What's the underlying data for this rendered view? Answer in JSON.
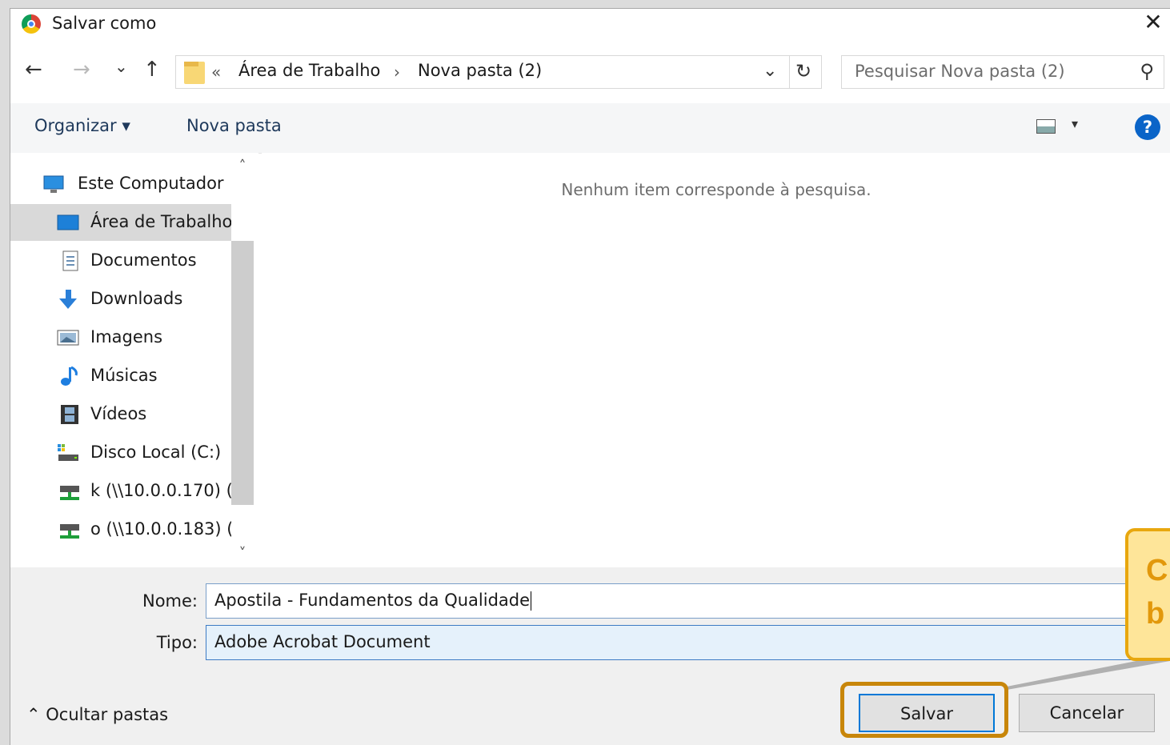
{
  "window": {
    "title": "Salvar como",
    "close_glyph": "✕"
  },
  "nav": {
    "back_glyph": "←",
    "forward_glyph": "→",
    "recent_glyph": "⌄",
    "up_glyph": "↑",
    "breadcrumb_overflow": "«",
    "breadcrumb": [
      "Área de Trabalho",
      "Nova pasta (2)"
    ],
    "breadcrumb_sep": "›",
    "dropdown_glyph": "⌄",
    "refresh_glyph": "↻",
    "search_placeholder": "Pesquisar Nova pasta (2)",
    "search_glyph": "⚲"
  },
  "toolbar": {
    "organize": "Organizar ▾",
    "new_folder": "Nova pasta",
    "view_dd": "▾",
    "help": "?"
  },
  "sidebar": {
    "items": [
      {
        "label": "Este Computador",
        "icon": "computer-icon"
      },
      {
        "label": "Área de Trabalho",
        "icon": "desktop-icon",
        "selected": true
      },
      {
        "label": "Documentos",
        "icon": "documents-icon"
      },
      {
        "label": "Downloads",
        "icon": "downloads-icon"
      },
      {
        "label": "Imagens",
        "icon": "pictures-icon"
      },
      {
        "label": "Músicas",
        "icon": "music-icon"
      },
      {
        "label": "Vídeos",
        "icon": "videos-icon"
      },
      {
        "label": "Disco Local (C:)",
        "icon": "drive-icon"
      },
      {
        "label": "k (\\\\10.0.0.170) (",
        "icon": "network-drive-icon"
      },
      {
        "label": "o (\\\\10.0.0.183) (",
        "icon": "network-drive-icon"
      }
    ],
    "scroll_up": "˄",
    "scroll_down": "˅"
  },
  "content": {
    "empty_message": "Nenhum item corresponde à pesquisa."
  },
  "form": {
    "name_label": "Nome:",
    "name_value": "Apostila - Fundamentos da Qualidade",
    "type_label": "Tipo:",
    "type_value": "Adobe Acrobat Document"
  },
  "footer": {
    "hide_folders": "⌃  Ocultar pastas",
    "save": "Salvar",
    "cancel": "Cancelar"
  },
  "callout": {
    "line1": "C",
    "line2": "b"
  },
  "colors": {
    "accent": "#0078d7",
    "callout_border": "#e8a70e",
    "callout_fill": "#fee599",
    "highlight": "#c8860a"
  }
}
